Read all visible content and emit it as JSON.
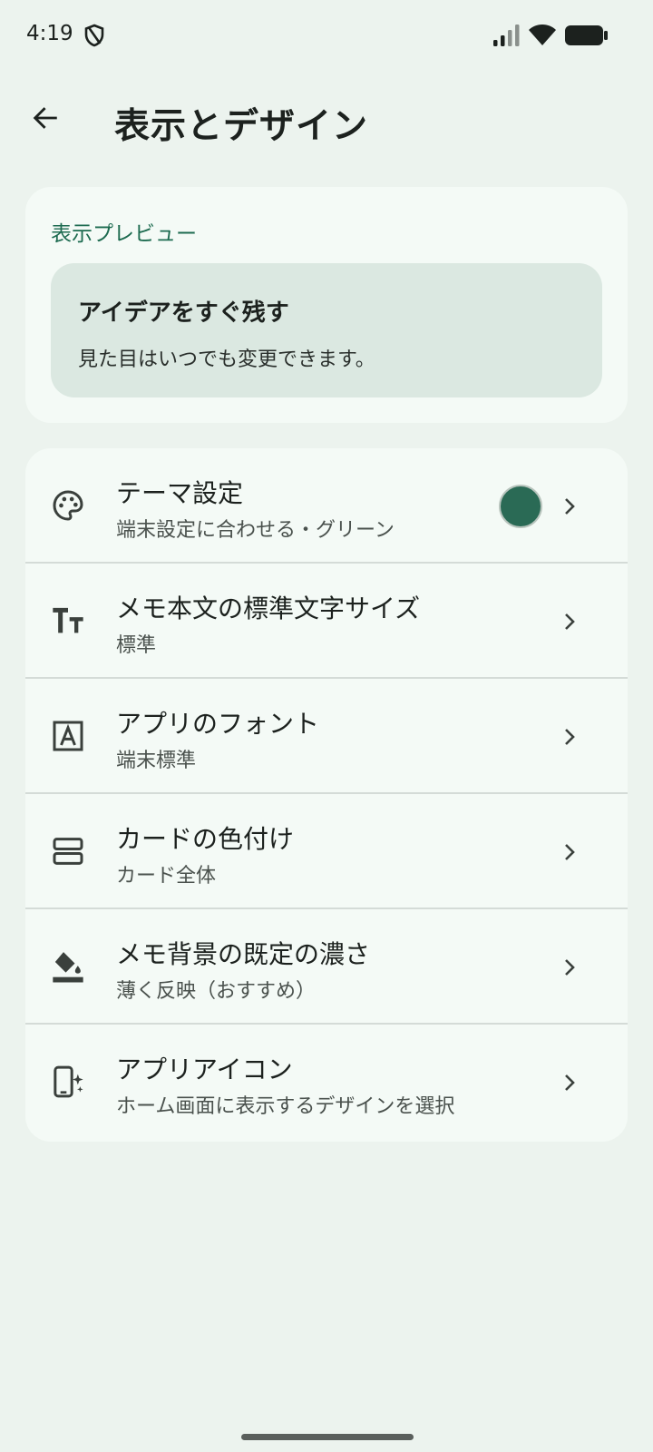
{
  "status_bar": {
    "time": "4:19",
    "icons": [
      "shield-icon",
      "signal-icon",
      "wifi-icon",
      "battery-icon"
    ]
  },
  "app_bar": {
    "back_icon": "arrow-back-icon",
    "title": "表示とデザイン"
  },
  "preview": {
    "header": "表示プレビュー",
    "title": "アイデアをすぐ残す",
    "subtitle": "見た目はいつでも変更できます。"
  },
  "settings": {
    "items": [
      {
        "icon": "palette-icon",
        "title": "テーマ設定",
        "subtitle": "端末設定に合わせる・グリーン",
        "swatch_color": "#2a6a55"
      },
      {
        "icon": "text-size-icon",
        "title": "メモ本文の標準文字サイズ",
        "subtitle": "標準"
      },
      {
        "icon": "font-icon",
        "title": "アプリのフォント",
        "subtitle": "端末標準"
      },
      {
        "icon": "card-layout-icon",
        "title": "カードの色付け",
        "subtitle": "カード全体"
      },
      {
        "icon": "paint-bucket-icon",
        "title": "メモ背景の既定の濃さ",
        "subtitle": "薄く反映（おすすめ）"
      },
      {
        "icon": "app-icon-icon",
        "title": "アプリアイコン",
        "subtitle": "ホーム画面に表示するデザインを選択"
      }
    ]
  },
  "colors": {
    "background": "#ecf3ee",
    "card": "#f4faf6",
    "accent": "#1d6b50",
    "preview_box": "#dbe8e1"
  }
}
